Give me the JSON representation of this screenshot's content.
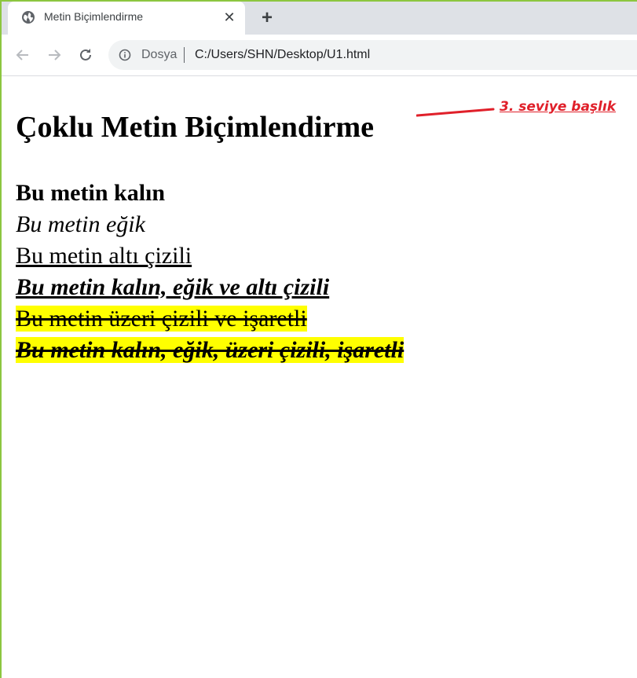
{
  "browser": {
    "tab_title": "Metin Biçimlendirme",
    "new_tab_symbol": "+",
    "close_symbol": "✕",
    "address_scheme_label": "Dosya",
    "address_url": "C:/Users/SHN/Desktop/U1.html"
  },
  "page": {
    "heading": "Çoklu Metin Biçimlendirme",
    "lines": {
      "bold": "Bu metin kalın",
      "italic": "Bu metin eğik",
      "underline": "Bu metin altı çizili",
      "bold_italic_underline": "Bu metin kalın, eğik ve altı çizili",
      "strike_mark": "Bu metin üzeri çizili ve işaretli",
      "bold_italic_strike_mark": "Bu metin kalın, eğik, üzeri çizili, işaretli"
    }
  },
  "annotation": {
    "text": "3. seviye başlık",
    "color": "#e0202a"
  },
  "colors": {
    "highlight": "#ffff00",
    "frame_border": "#8cc63f",
    "tabstrip": "#dee1e6"
  }
}
